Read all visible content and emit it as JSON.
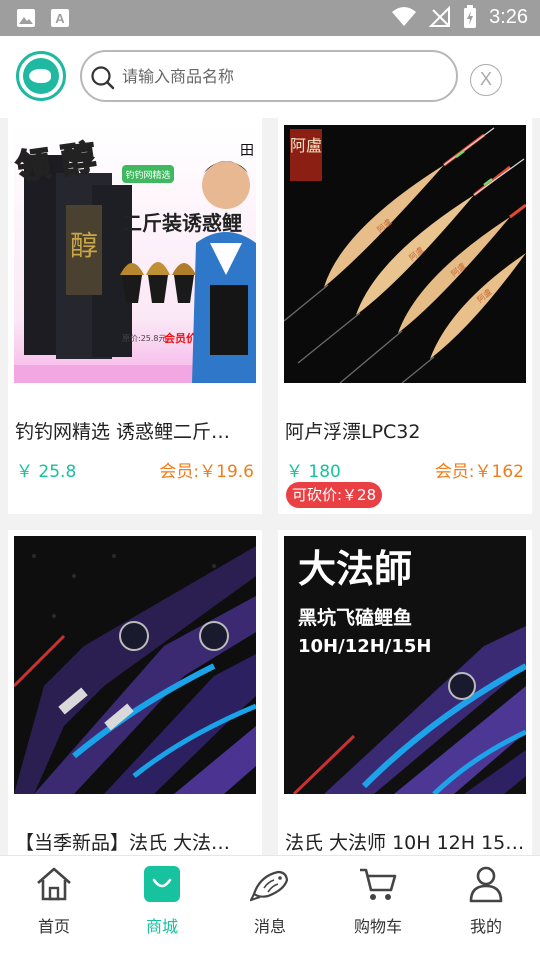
{
  "status_bar": {
    "time": "3:26"
  },
  "search": {
    "placeholder": "请输入商品名称",
    "value": "",
    "clear_label": "X"
  },
  "products": [
    {
      "title": "钓钓网精选 诱惑鲤二斤…",
      "price": "￥ 25.8",
      "member_price": "会员:￥19.6",
      "image_text": {
        "badge": "领 醇",
        "headline": "二斤装诱惑鲤",
        "ribbon": "钓钓网精选",
        "tag_original": "原价:25.8元",
        "tag_member": "会员价19.8元"
      }
    },
    {
      "title": "阿卢浮漂LPC32",
      "price": "￥ 180",
      "member_price": "会员:￥162",
      "bargain": "可砍价:￥28",
      "image_text": {
        "brand": "阿盧"
      }
    },
    {
      "title": "【当季新品】法氏 大法…",
      "price": "",
      "member_price": ""
    },
    {
      "title": "法氏 大法师 10H 12H 15…",
      "price": "",
      "member_price": "",
      "image_text": {
        "brand": "大法師",
        "subtitle": "黑坑飞磕鲤鱼",
        "models": "10H/12H/15H"
      }
    }
  ],
  "tabbar": [
    {
      "label": "首页",
      "icon": "home-icon"
    },
    {
      "label": "商城",
      "icon": "shopping-bag-icon",
      "active": true
    },
    {
      "label": "消息",
      "icon": "fish-icon"
    },
    {
      "label": "购物车",
      "icon": "cart-icon"
    },
    {
      "label": "我的",
      "icon": "user-icon"
    }
  ],
  "colors": {
    "accent": "#17c29e",
    "member_price": "#ef7d1b",
    "bargain": "#ea4044",
    "status_bar": "#9e9e9e"
  }
}
